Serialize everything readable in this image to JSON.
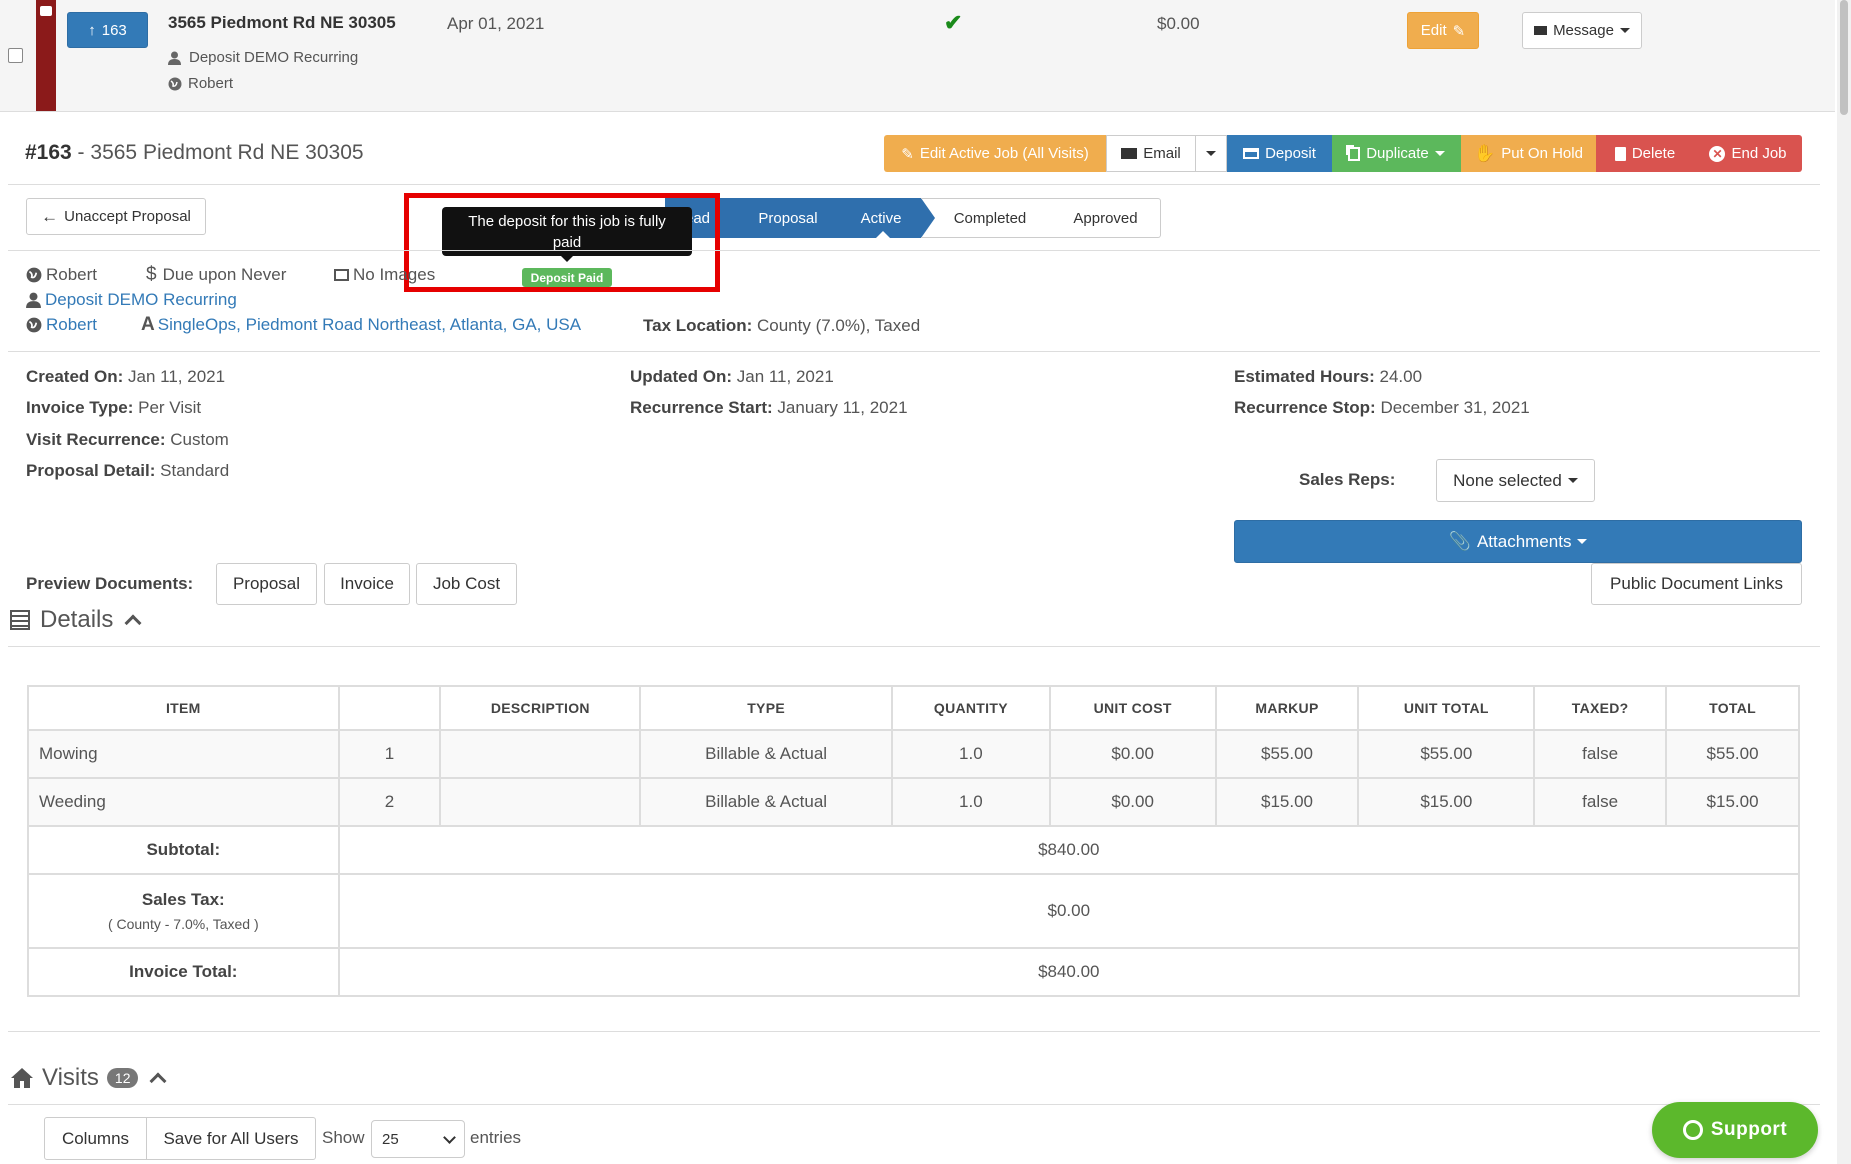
{
  "top_row": {
    "job_number_button": "163",
    "address": "3565 Piedmont Rd NE 30305",
    "date": "Apr 01, 2021",
    "amount": "$0.00",
    "customer": "Deposit DEMO Recurring",
    "owner": "Robert",
    "edit_label": "Edit",
    "message_label": "Message"
  },
  "header": {
    "job_id": "#163",
    "separator": " - ",
    "address": "3565 Piedmont Rd NE 30305"
  },
  "actions": {
    "edit_active_job": "Edit Active Job (All Visits)",
    "email": "Email",
    "deposit": "Deposit",
    "duplicate": "Duplicate",
    "put_on_hold": "Put On Hold",
    "delete": "Delete",
    "end_job": "End Job"
  },
  "unaccept_proposal": "Unaccept Proposal",
  "pipeline": {
    "steps": [
      "Lead",
      "Proposal",
      "Active",
      "Completed",
      "Approved"
    ],
    "visible_lead_text": "ead"
  },
  "tooltip": {
    "text": "The deposit for this job is fully paid",
    "badge": "Deposit Paid"
  },
  "info": {
    "owner": "Robert",
    "due": "Due upon Never",
    "images": "No Images",
    "customer": "Deposit DEMO Recurring",
    "owner_link": "Robert",
    "location": "SingleOps, Piedmont Road Northeast, Atlanta, GA, USA",
    "tax_location_label": "Tax Location:",
    "tax_location_value": "County (7.0%), Taxed"
  },
  "details_fields": {
    "created_on_label": "Created On:",
    "created_on": "Jan 11, 2021",
    "invoice_type_label": "Invoice Type:",
    "invoice_type": "Per Visit",
    "visit_recurrence_label": "Visit Recurrence:",
    "visit_recurrence": "Custom",
    "proposal_detail_label": "Proposal Detail:",
    "proposal_detail": "Standard",
    "updated_on_label": "Updated On:",
    "updated_on": "Jan 11, 2021",
    "recurrence_start_label": "Recurrence Start:",
    "recurrence_start": "January 11, 2021",
    "estimated_hours_label": "Estimated Hours:",
    "estimated_hours": "24.00",
    "recurrence_stop_label": "Recurrence Stop:",
    "recurrence_stop": "December 31, 2021",
    "sales_reps_label": "Sales Reps:",
    "sales_reps_value": "None selected"
  },
  "attachments_label": "Attachments",
  "public_document_links": "Public Document Links",
  "preview": {
    "label": "Preview Documents:",
    "buttons": [
      "Proposal",
      "Invoice",
      "Job Cost"
    ]
  },
  "details_section": {
    "title": "Details"
  },
  "table": {
    "headers": [
      "ITEM",
      "",
      "DESCRIPTION",
      "TYPE",
      "QUANTITY",
      "UNIT COST",
      "MARKUP",
      "UNIT TOTAL",
      "TAXED?",
      "TOTAL"
    ],
    "rows": [
      [
        "Mowing",
        "1",
        "",
        "Billable & Actual",
        "1.0",
        "$0.00",
        "$55.00",
        "$55.00",
        "false",
        "$55.00"
      ],
      [
        "Weeding",
        "2",
        "",
        "Billable & Actual",
        "1.0",
        "$0.00",
        "$15.00",
        "$15.00",
        "false",
        "$15.00"
      ]
    ],
    "subtotal_label": "Subtotal:",
    "subtotal": "$840.00",
    "sales_tax_label": "Sales Tax:",
    "sales_tax_note": "( County - 7.0%, Taxed )",
    "sales_tax": "$0.00",
    "invoice_total_label": "Invoice Total:",
    "invoice_total": "$840.00"
  },
  "visits": {
    "title": "Visits",
    "count": "12"
  },
  "datatable_controls": {
    "columns": "Columns",
    "save_for_all": "Save for All Users",
    "show": "Show",
    "page_size": "25",
    "entries": "entries"
  },
  "support_label": "Support",
  "colors": {
    "primary": "#337ab7",
    "warning": "#f0ad4e",
    "success": "#5cb85c",
    "danger": "#d9534f",
    "dark_red_strip": "#8b1a1a",
    "support_green": "#5cb82c",
    "highlight_red": "#e60000"
  }
}
